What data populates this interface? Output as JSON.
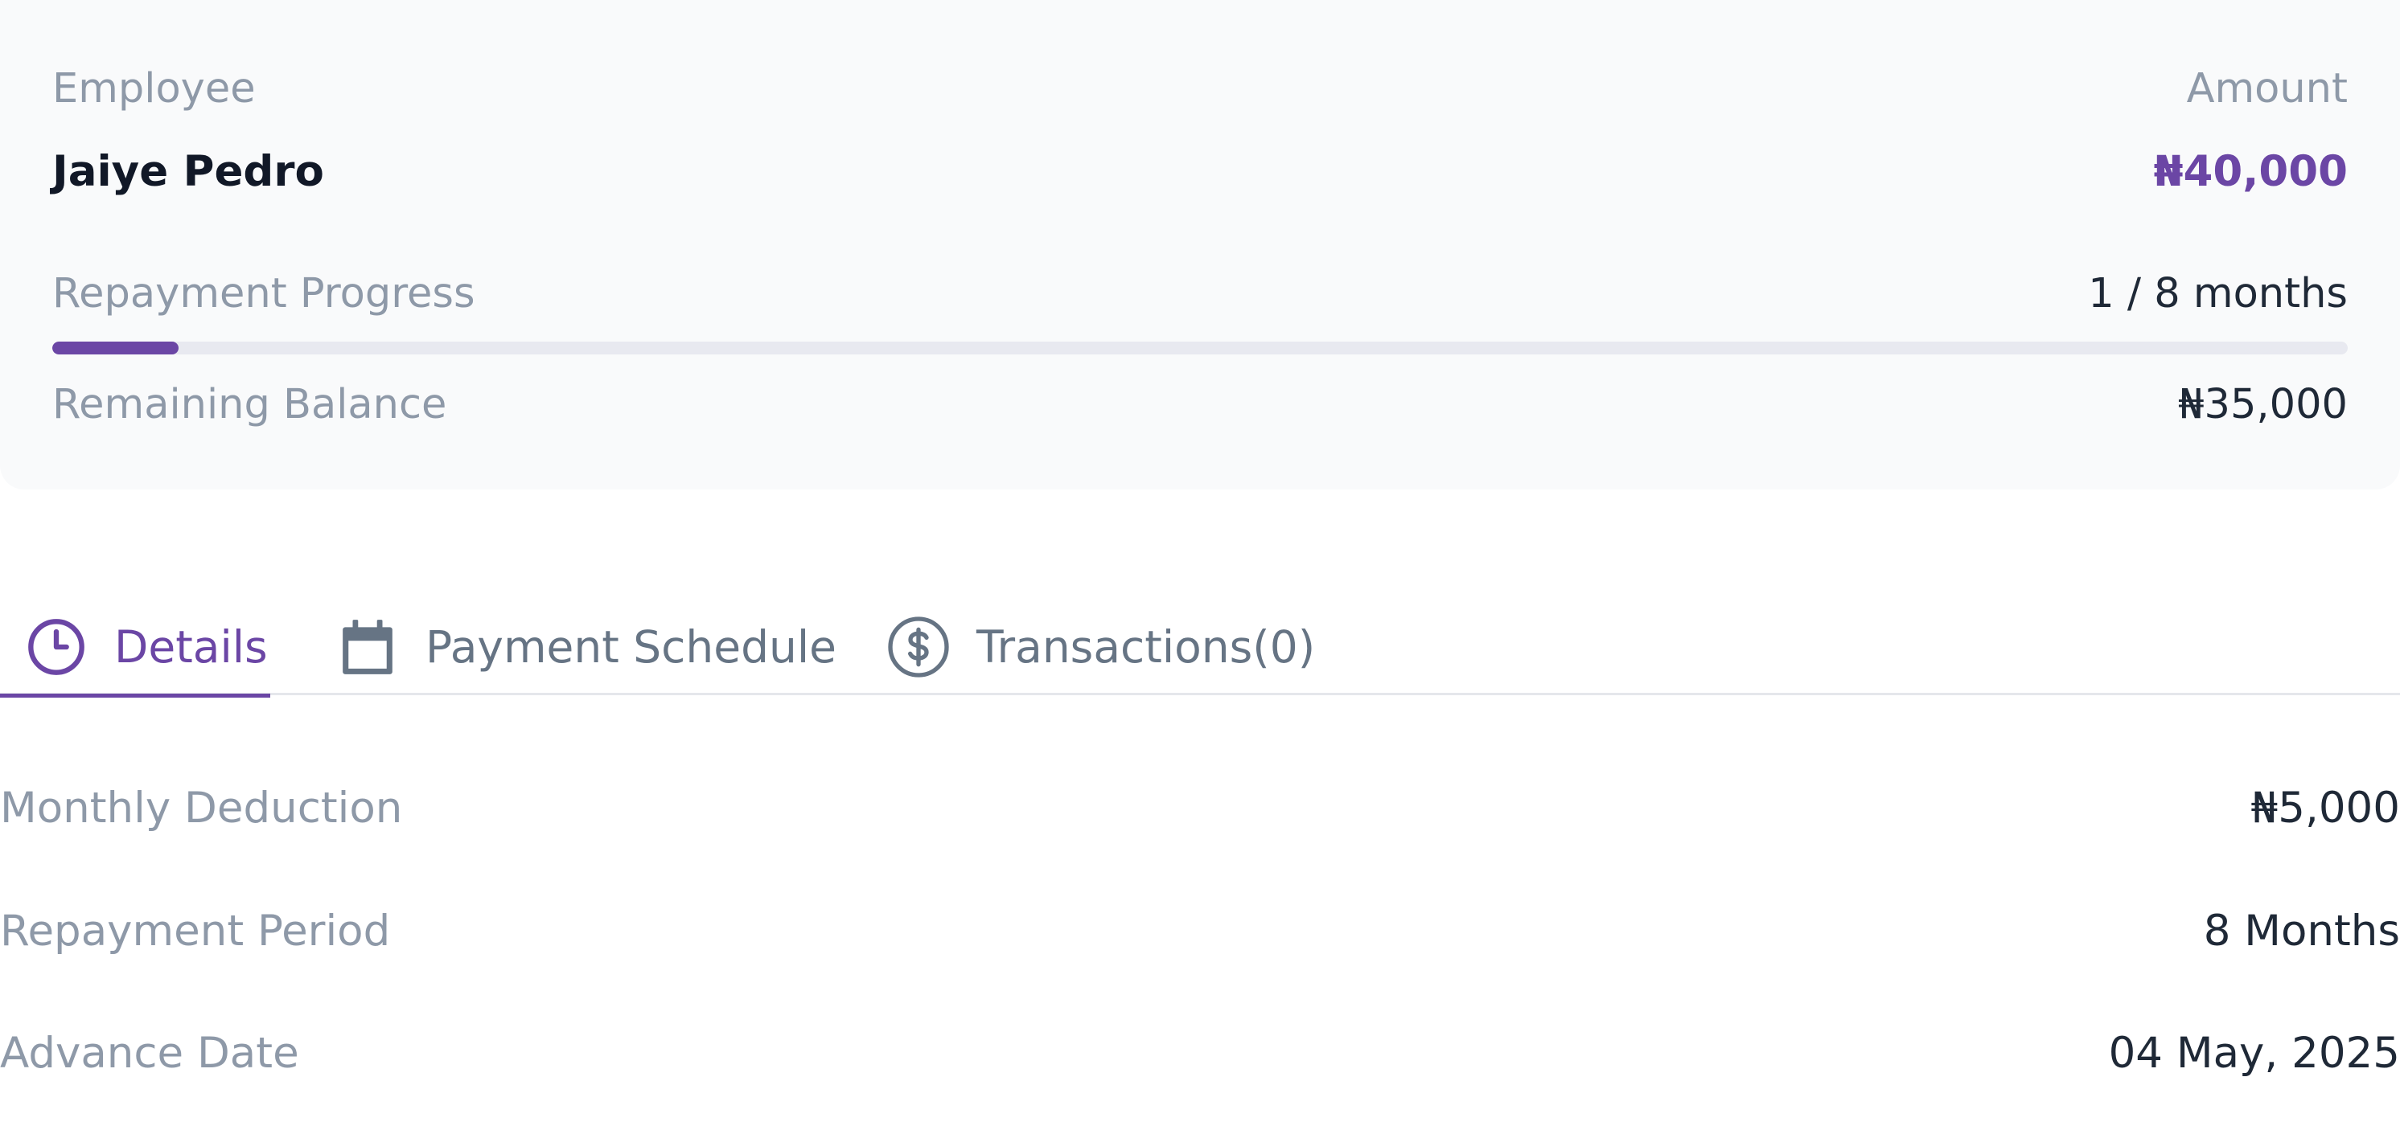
{
  "summary": {
    "employee_label": "Employee",
    "amount_label": "Amount",
    "employee_name": "Jaiye Pedro",
    "amount_value": "₦40,000",
    "progress_label": "Repayment Progress",
    "progress_value": "1 / 8 months",
    "progress_fraction": 0.055,
    "balance_label": "Remaining Balance",
    "balance_value": "₦35,000"
  },
  "tabs": [
    {
      "label": "Details",
      "icon": "clock-icon",
      "active": true
    },
    {
      "label": "Payment Schedule",
      "icon": "calendar-icon",
      "active": false
    },
    {
      "label": "Transactions(0)",
      "icon": "dollar-circle-icon",
      "active": false
    }
  ],
  "details": [
    {
      "label": "Monthly Deduction",
      "value": "₦5,000"
    },
    {
      "label": "Repayment Period",
      "value": "8 Months"
    },
    {
      "label": "Advance Date",
      "value": "04 May, 2025"
    }
  ],
  "colors": {
    "accent": "#6b46a5",
    "muted_text": "#8e99a8",
    "card_background": "#f9fafb"
  }
}
